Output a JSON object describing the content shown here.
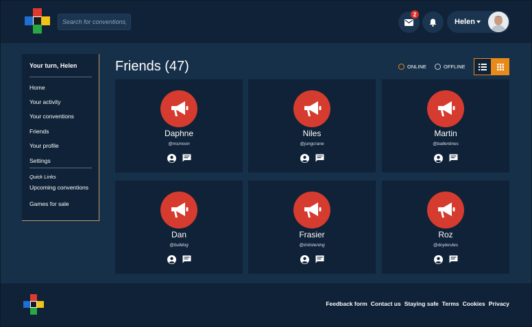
{
  "brand": {
    "colors": {
      "red": "#e03a2f",
      "blue": "#1f6fd1",
      "green": "#28a745",
      "yellow": "#f2c418",
      "dark": "#1b1b1b"
    }
  },
  "header": {
    "search_placeholder": "Search for conventions, pe",
    "messages": {
      "icon": "envelope-icon",
      "badge": "2"
    },
    "notifications_icon": "bell-icon",
    "user": {
      "name": "Helen",
      "avatar_icon": "user-photo"
    }
  },
  "sidebar": {
    "greeting": "Your turn, Helen",
    "items": [
      "Home",
      "Your activity",
      "Your conventions",
      "Friends",
      "Your profile",
      "Settings"
    ],
    "quick_links_label": "Quick Links",
    "quick_links": [
      "Upcoming conventions",
      "Games for sale"
    ]
  },
  "main": {
    "title": "Friends (47)",
    "filters": {
      "online": "ONLINE",
      "offline": "OFFLINE"
    },
    "accent": "#e88a1a",
    "avatar_color": "#d63b2f",
    "friends": [
      {
        "name": "Daphne",
        "handle": "@msmoon"
      },
      {
        "name": "Niles",
        "handle": "@jungcrane"
      },
      {
        "name": "Martin",
        "handle": "@ballentines"
      },
      {
        "name": "Dan",
        "handle": "@bulldog"
      },
      {
        "name": "Frasier",
        "handle": "@imlistening"
      },
      {
        "name": "Roz",
        "handle": "@doylerules"
      }
    ]
  },
  "footer": {
    "links": [
      "Feedback form",
      "Contact us",
      "Staying safe",
      "Terms",
      "Cookies",
      "Privacy"
    ]
  }
}
